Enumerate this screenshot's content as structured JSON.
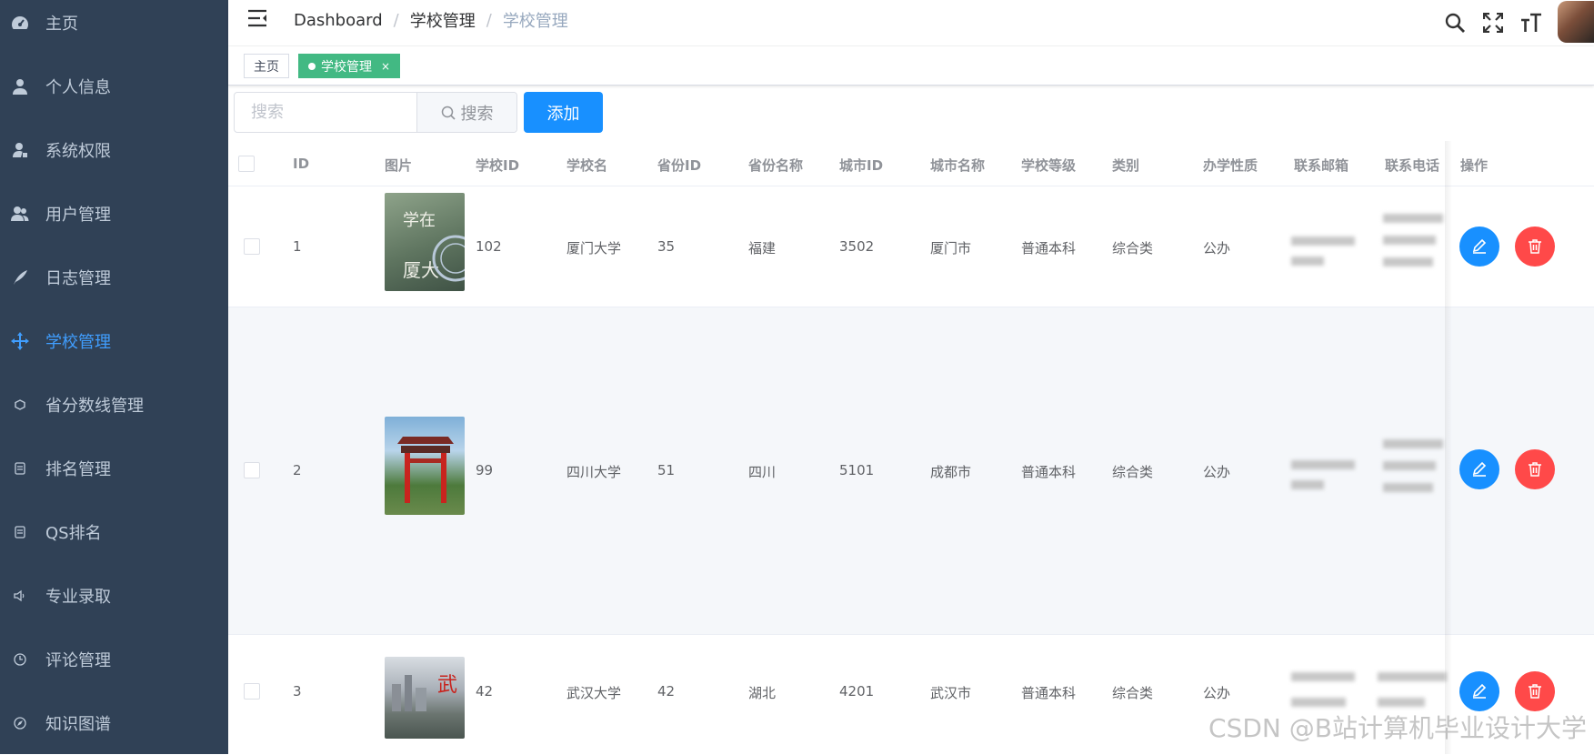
{
  "sidebar": {
    "items": [
      {
        "label": "主页",
        "icon": "dashboard-icon",
        "active": false
      },
      {
        "label": "个人信息",
        "icon": "user-icon",
        "active": false
      },
      {
        "label": "系统权限",
        "icon": "permission-icon",
        "active": false
      },
      {
        "label": "用户管理",
        "icon": "users-icon",
        "active": false
      },
      {
        "label": "日志管理",
        "icon": "feather-icon",
        "active": false
      },
      {
        "label": "学校管理",
        "icon": "move-icon",
        "active": true
      },
      {
        "label": "省分数线管理",
        "icon": "cube-icon",
        "active": false
      },
      {
        "label": "排名管理",
        "icon": "list-icon",
        "active": false
      },
      {
        "label": "QS排名",
        "icon": "list-icon",
        "active": false
      },
      {
        "label": "专业录取",
        "icon": "speaker-icon",
        "active": false
      },
      {
        "label": "评论管理",
        "icon": "clock-icon",
        "active": false
      },
      {
        "label": "知识图谱",
        "icon": "compass-icon",
        "active": false
      }
    ]
  },
  "header": {
    "breadcrumb": [
      "Dashboard",
      "学校管理",
      "学校管理"
    ],
    "icons": [
      "search-icon",
      "fullscreen-icon",
      "font-size-icon"
    ]
  },
  "tags": [
    {
      "label": "主页",
      "active": false
    },
    {
      "label": "学校管理",
      "active": true,
      "close": "×"
    }
  ],
  "search": {
    "placeholder": "搜索",
    "button_label": "搜索",
    "add_label": "添加"
  },
  "table": {
    "columns": [
      "ID",
      "图片",
      "学校ID",
      "学校名",
      "省份ID",
      "省份名称",
      "城市ID",
      "城市名称",
      "学校等级",
      "类别",
      "办学性质",
      "联系邮箱",
      "联系电话",
      "操作"
    ],
    "rows": [
      {
        "id": "1",
        "school_id": "102",
        "name": "厦门大学",
        "province_id": "35",
        "province": "福建",
        "city_id": "3502",
        "city": "厦门市",
        "level": "普通本科",
        "category": "综合类",
        "nature": "公办"
      },
      {
        "id": "2",
        "school_id": "99",
        "name": "四川大学",
        "province_id": "51",
        "province": "四川",
        "city_id": "5101",
        "city": "成都市",
        "level": "普通本科",
        "category": "综合类",
        "nature": "公办"
      },
      {
        "id": "3",
        "school_id": "42",
        "name": "武汉大学",
        "province_id": "42",
        "province": "湖北",
        "city_id": "4201",
        "city": "武汉市",
        "level": "普通本科",
        "category": "综合类",
        "nature": "公办"
      }
    ]
  },
  "colors": {
    "sidebar_bg": "#304156",
    "active": "#409eff",
    "primary": "#1890ff",
    "danger": "#ff4949",
    "tag_active": "#42b983"
  },
  "watermark": "CSDN @B站计算机毕业设计大学"
}
